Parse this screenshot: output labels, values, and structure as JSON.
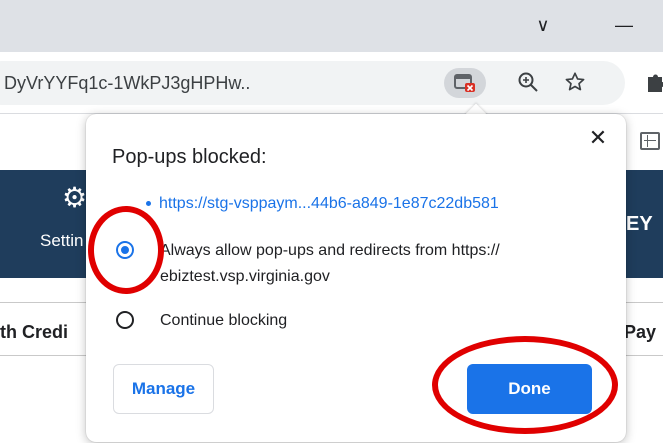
{
  "browser": {
    "url": "DyVrYYFq1c-1WkPJ3gHPHw..",
    "window_controls": {
      "chevron": "∨",
      "minimize": "—"
    }
  },
  "page_behind": {
    "settings_label": "Settin",
    "ey_label": "EY",
    "credit_label": "th Credi",
    "pay_label": "Pay"
  },
  "popup": {
    "title": "Pop-ups blocked:",
    "blocked_url": "https://stg-vsppaym...44b6-a849-1e87c22db581",
    "options": [
      {
        "label_line1": "Always allow pop-ups and redirects from https://",
        "label_line2": "ebiztest.vsp.virginia.gov",
        "selected": true
      },
      {
        "label_line1": "Continue blocking",
        "selected": false
      }
    ],
    "manage_label": "Manage",
    "done_label": "Done",
    "close_glyph": "✕"
  },
  "colors": {
    "accent": "#1a73e8",
    "annotation": "#e00000",
    "header_dark": "#1f3d5c"
  }
}
